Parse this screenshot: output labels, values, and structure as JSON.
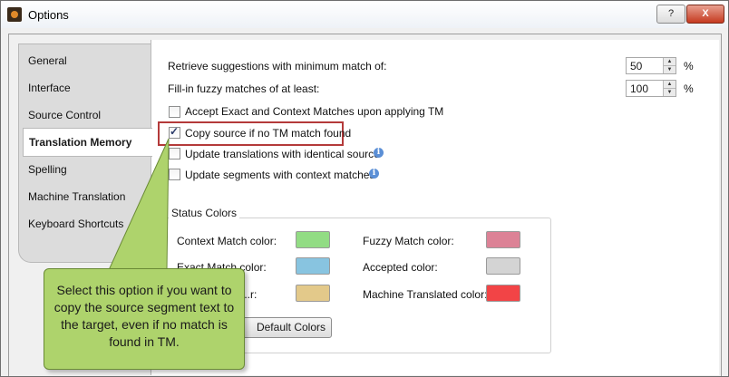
{
  "window": {
    "title": "Options",
    "help_label": "?",
    "close_label": "X"
  },
  "sidebar": {
    "items": [
      {
        "label": "General"
      },
      {
        "label": "Interface"
      },
      {
        "label": "Source Control"
      },
      {
        "label": "Translation Memory",
        "selected": true
      },
      {
        "label": "Spelling"
      },
      {
        "label": "Machine Translation"
      },
      {
        "label": "Keyboard Shortcuts"
      }
    ]
  },
  "settings": {
    "min_match_label": "Retrieve suggestions with minimum match of:",
    "min_match_value": "50",
    "fuzzy_label": "Fill-in fuzzy matches of at least:",
    "fuzzy_value": "100",
    "percent": "%",
    "checkboxes": [
      {
        "label": "Accept Exact and Context Matches upon applying TM",
        "checked": false
      },
      {
        "label": "Copy source if no TM match found",
        "checked": true
      },
      {
        "label": "Update translations with identical source",
        "checked": false
      },
      {
        "label": "Update segments with context matches",
        "checked": false
      }
    ]
  },
  "status_colors": {
    "title": "Status Colors",
    "items": [
      {
        "label": "Context Match color:",
        "color": "#92dc84"
      },
      {
        "label": "Exact Match color:",
        "color": "#88c4e0"
      },
      {
        "label": "...r:",
        "color": "#e3c98a"
      },
      {
        "label": "Fuzzy Match color:",
        "color": "#dc8296"
      },
      {
        "label": "Accepted color:",
        "color": "#d4d4d4"
      },
      {
        "label": "Machine Translated color:",
        "color": "#f24446"
      }
    ],
    "default_button_label": "Default Colors"
  },
  "callout": {
    "text": "Select this option if you want to copy the source segment text to the target, even if no match is found in TM."
  }
}
